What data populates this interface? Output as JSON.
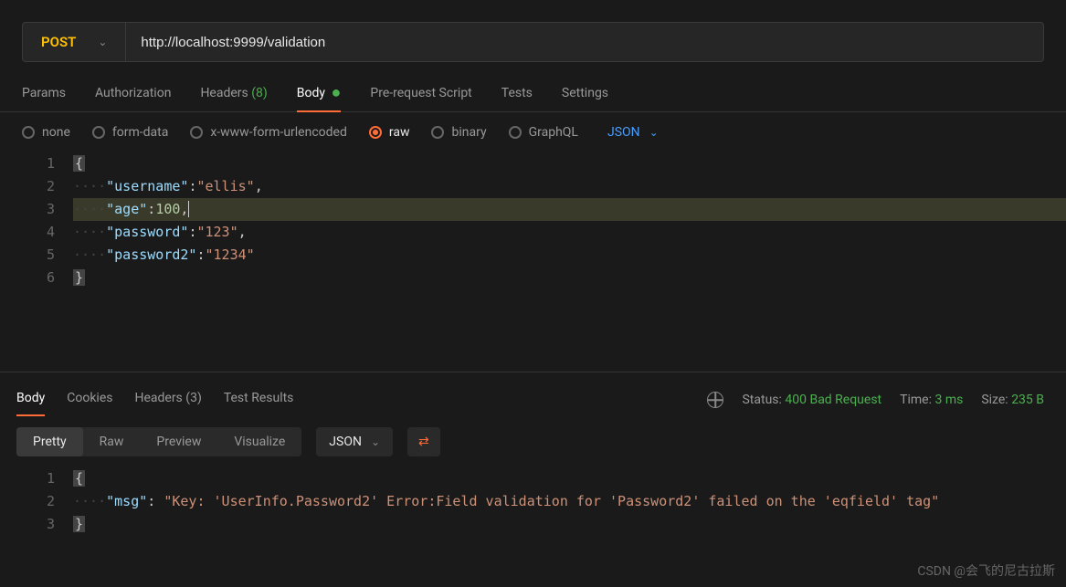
{
  "request": {
    "method": "POST",
    "url": "http://localhost:9999/validation"
  },
  "tabs": {
    "params": "Params",
    "auth": "Authorization",
    "headers_label": "Headers",
    "headers_count": "(8)",
    "body": "Body",
    "prescript": "Pre-request Script",
    "tests": "Tests",
    "settings": "Settings"
  },
  "body_types": {
    "none": "none",
    "form_data": "form-data",
    "urlencoded": "x-www-form-urlencoded",
    "raw": "raw",
    "binary": "binary",
    "graphql": "GraphQL",
    "lang": "JSON"
  },
  "editor": {
    "lines": [
      "1",
      "2",
      "3",
      "4",
      "5",
      "6"
    ],
    "l1_brace": "{",
    "l2_key": "\"username\"",
    "l2_val": "\"ellis\"",
    "l3_key": "\"age\"",
    "l3_val": "100",
    "l4_key": "\"password\"",
    "l4_val": "\"123\"",
    "l5_key": "\"password2\"",
    "l5_val": "\"1234\"",
    "l6_brace": "}",
    "dots": "····"
  },
  "response": {
    "tabs": {
      "body": "Body",
      "cookies": "Cookies",
      "headers_label": "Headers",
      "headers_count": "(3)",
      "test_results": "Test Results"
    },
    "status_label": "Status:",
    "status_value": "400 Bad Request",
    "time_label": "Time:",
    "time_value": "3 ms",
    "size_label": "Size:",
    "size_value": "235 B",
    "views": {
      "pretty": "Pretty",
      "raw": "Raw",
      "preview": "Preview",
      "visualize": "Visualize",
      "format": "JSON"
    },
    "editor": {
      "lines": [
        "1",
        "2",
        "3"
      ],
      "l1_brace": "{",
      "l2_key": "\"msg\"",
      "l2_val": "\"Key: 'UserInfo.Password2' Error:Field validation for 'Password2' failed on the 'eqfield' tag\"",
      "l3_brace": "}",
      "dots": "····"
    }
  },
  "watermark": "CSDN @会飞的尼古拉斯"
}
